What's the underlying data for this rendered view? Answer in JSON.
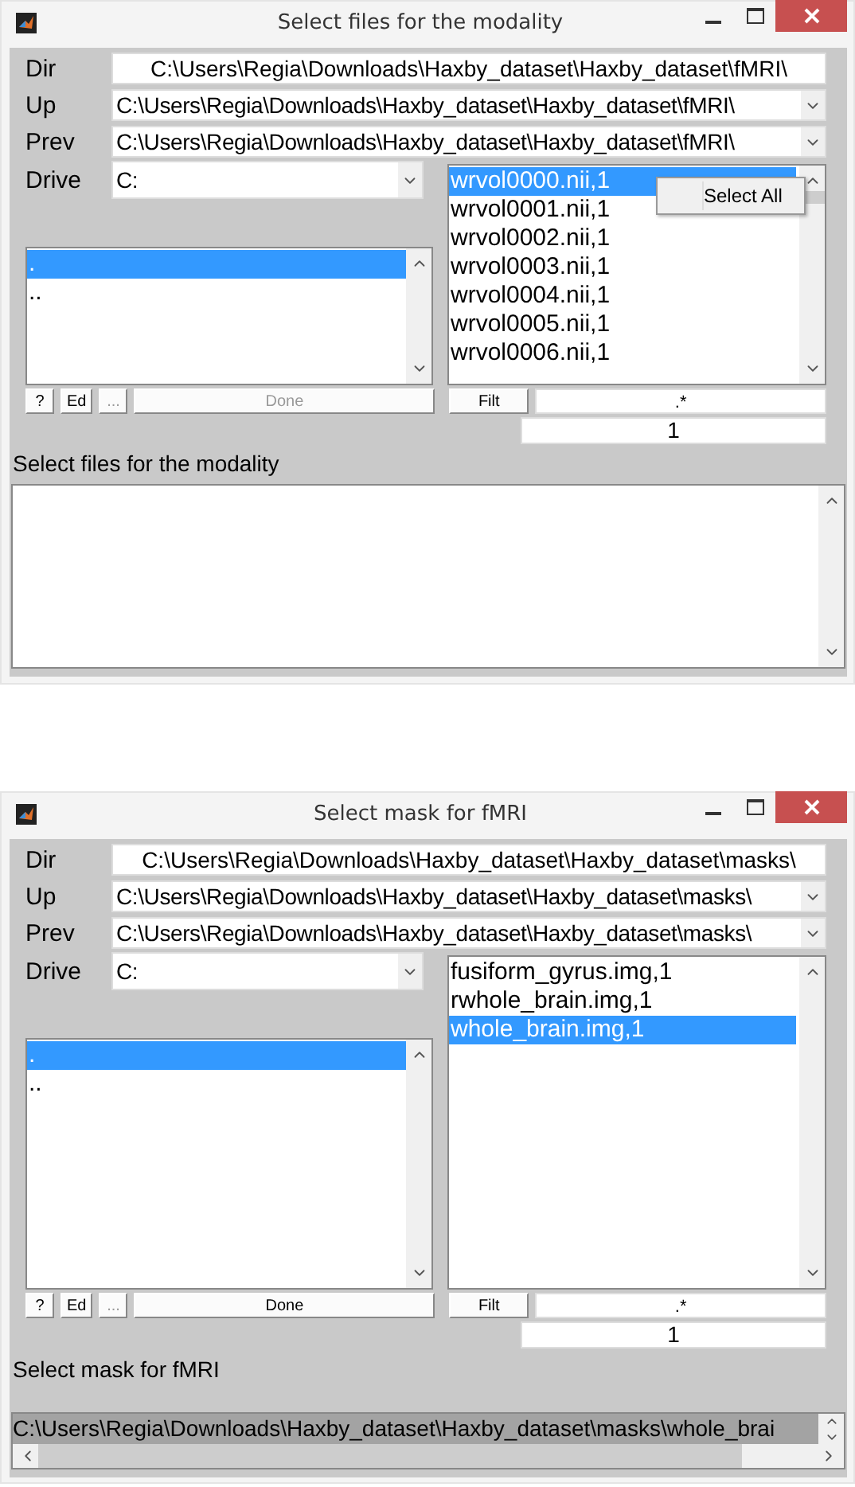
{
  "windows": [
    {
      "title": "Select files for the modality",
      "path_rows": [
        {
          "label": "Dir",
          "value": "C:\\Users\\Regia\\Downloads\\Haxby_dataset\\Haxby_dataset\\fMRI\\",
          "kind": "text"
        },
        {
          "label": "Up",
          "value": "C:\\Users\\Regia\\Downloads\\Haxby_dataset\\Haxby_dataset\\fMRI\\",
          "kind": "dropdown"
        },
        {
          "label": "Prev",
          "value": "C:\\Users\\Regia\\Downloads\\Haxby_dataset\\Haxby_dataset\\fMRI\\",
          "kind": "dropdown"
        }
      ],
      "drive": {
        "label": "Drive",
        "value": "C:"
      },
      "directories": [
        {
          "label": ".",
          "selected": true
        },
        {
          "label": "..",
          "selected": false
        }
      ],
      "files": [
        {
          "label": "wrvol0000.nii,1",
          "selected": true
        },
        {
          "label": "wrvol0001.nii,1",
          "selected": false
        },
        {
          "label": "wrvol0002.nii,1",
          "selected": false
        },
        {
          "label": "wrvol0003.nii,1",
          "selected": false
        },
        {
          "label": "wrvol0004.nii,1",
          "selected": false
        },
        {
          "label": "wrvol0005.nii,1",
          "selected": false
        },
        {
          "label": "wrvol0006.nii,1",
          "selected": false
        }
      ],
      "context_menu": [
        "Select All"
      ],
      "buttons": [
        {
          "label": "?",
          "disabled": false
        },
        {
          "label": "Ed",
          "disabled": false
        },
        {
          "label": "...",
          "disabled": true
        },
        {
          "label": "Done",
          "disabled": true
        }
      ],
      "filter_button": "Filt",
      "filter": ".*",
      "frames": "1",
      "prompt": "Select files for the modality"
    },
    {
      "title": "Select mask for fMRI",
      "path_rows": [
        {
          "label": "Dir",
          "value": "C:\\Users\\Regia\\Downloads\\Haxby_dataset\\Haxby_dataset\\masks\\",
          "kind": "text"
        },
        {
          "label": "Up",
          "value": "C:\\Users\\Regia\\Downloads\\Haxby_dataset\\Haxby_dataset\\masks\\",
          "kind": "dropdown"
        },
        {
          "label": "Prev",
          "value": "C:\\Users\\Regia\\Downloads\\Haxby_dataset\\Haxby_dataset\\masks\\",
          "kind": "dropdown"
        }
      ],
      "drive": {
        "label": "Drive",
        "value": "C:"
      },
      "directories": [
        {
          "label": ".",
          "selected": true
        },
        {
          "label": "..",
          "selected": false
        }
      ],
      "files": [
        {
          "label": "fusiform_gyrus.img,1",
          "selected": false
        },
        {
          "label": "rwhole_brain.img,1",
          "selected": false
        },
        {
          "label": "whole_brain.img,1",
          "selected": true
        }
      ],
      "buttons": [
        {
          "label": "?",
          "disabled": false
        },
        {
          "label": "Ed",
          "disabled": false
        },
        {
          "label": "...",
          "disabled": true
        },
        {
          "label": "Done",
          "disabled": false
        }
      ],
      "filter_button": "Filt",
      "filter": ".*",
      "frames": "1",
      "prompt": "Select mask for fMRI",
      "selected_files": [
        "C:\\Users\\Regia\\Downloads\\Haxby_dataset\\Haxby_dataset\\masks\\whole_brai"
      ]
    }
  ]
}
